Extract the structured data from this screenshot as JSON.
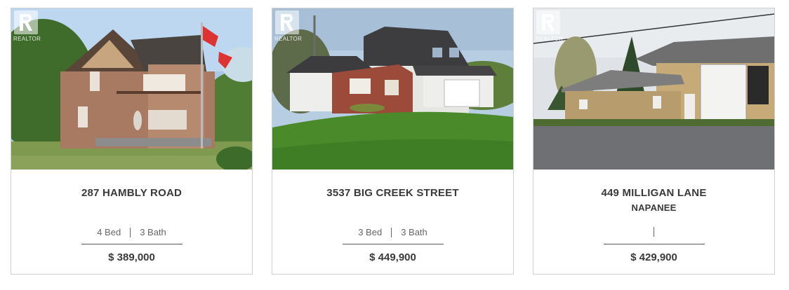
{
  "listings": [
    {
      "address": "287 HAMBLY ROAD",
      "city": "",
      "beds": "4 Bed",
      "baths": "3 Bath",
      "price": "$ 389,000",
      "logo_text": "REALTOR"
    },
    {
      "address": "3537 BIG CREEK STREET",
      "city": "",
      "beds": "3 Bed",
      "baths": "3 Bath",
      "price": "$ 449,900",
      "logo_text": "REALTOR"
    },
    {
      "address": "449 MILLIGAN LANE",
      "city": "NAPANEE",
      "beds": "",
      "baths": "",
      "price": "$ 429,900",
      "logo_text": "REALTOR"
    }
  ],
  "colors": {
    "border": "#cfcfcf",
    "text": "#3a3a3a",
    "muted": "#666666"
  }
}
